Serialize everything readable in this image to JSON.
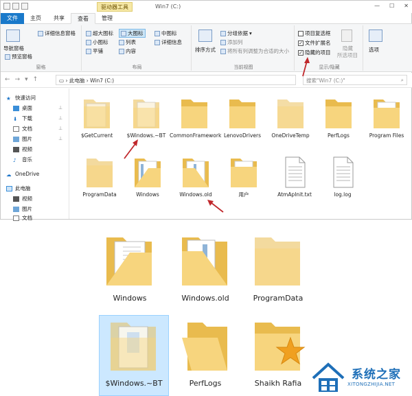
{
  "window": {
    "context_tab": "驱动器工具",
    "title": "Win7 (C:)"
  },
  "tabs": [
    "文件",
    "主页",
    "共享",
    "查看",
    "管理"
  ],
  "ribbon": {
    "panes": {
      "nav_pane": "导航窗格",
      "preview_pane": "预览窗格",
      "details_pane": "详细信息窗格",
      "label": "窗格"
    },
    "layout": {
      "items": [
        "超大图标",
        "大图标",
        "中图标",
        "小图标",
        "列表",
        "详细信息",
        "平铺",
        "内容"
      ],
      "label": "布局"
    },
    "current_view": {
      "sort": "排序方式",
      "group_by": "分组依据",
      "add_columns": "添加列",
      "fit_columns": "将所有列调整为合适的大小",
      "label": "当前视图"
    },
    "show_hide": {
      "item_checkboxes": "项目复选框",
      "file_extensions": "文件扩展名",
      "hidden_items": "隐藏的项目",
      "hide_selected": "隐藏",
      "selected_items": "所选项目",
      "label": "显示/隐藏"
    },
    "options": "选项"
  },
  "address": {
    "path_pc": "此电脑",
    "path_drive": "Win7 (C:)",
    "search_placeholder": "搜索\"Win7 (C:)\""
  },
  "sidebar": {
    "quick_access": "快速访问",
    "items": [
      "桌面",
      "下载",
      "文档",
      "图片",
      "视频",
      "音乐"
    ],
    "onedrive": "OneDrive",
    "this_pc": "此电脑",
    "pc_items": [
      "视频",
      "图片",
      "文档"
    ]
  },
  "files": [
    "$GetCurrent",
    "$Windows.~BT",
    "CommonFramework",
    "LenovoDrivers",
    "OneDriveTemp",
    "PerfLogs",
    "Program Files",
    "ProgramData",
    "Windows",
    "Windows.old",
    "用户",
    "AtmApInit.txt",
    "log.log"
  ],
  "big_icons_row1": [
    "Windows",
    "Windows.old",
    "ProgramData"
  ],
  "big_icons_row2": [
    "$Windows.~BT",
    "PerfLogs",
    "Shaikh Rafia"
  ],
  "watermark": {
    "title": "系统之家",
    "url": "XITONGZHIJIA.NET"
  },
  "colors": {
    "file_tab": "#1979ca",
    "folder": "#f7d57e",
    "folder_dark": "#e9bb4e",
    "arrow": "#c0282c",
    "selection": "#cce8ff"
  }
}
